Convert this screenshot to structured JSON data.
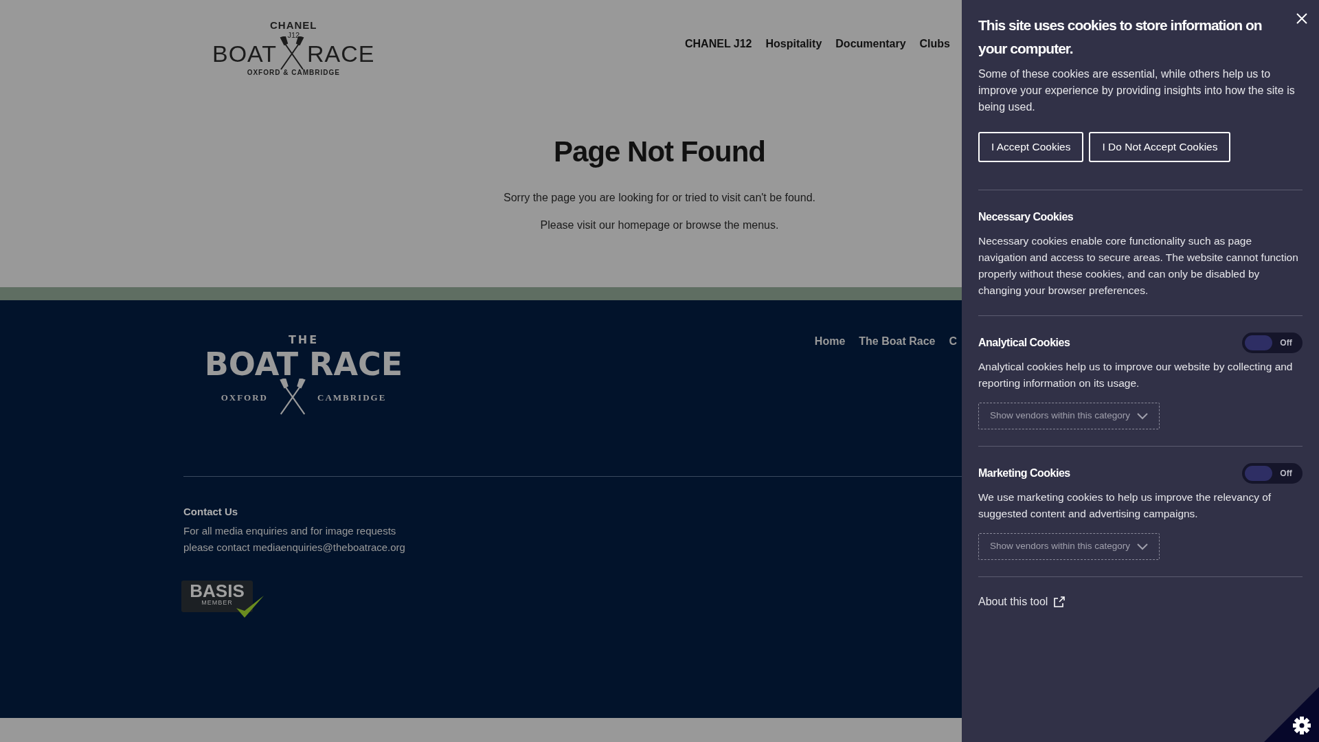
{
  "header": {
    "logo": {
      "top": "CHANEL",
      "model": "J12",
      "left": "BOAT",
      "right": "RACE",
      "bottom": "OXFORD & CAMBRIDGE"
    },
    "nav": [
      "CHANEL J12",
      "Hospitality",
      "Documentary",
      "Clubs"
    ]
  },
  "main": {
    "title": "Page Not Found",
    "lines": [
      "Sorry the page you are looking for or tried to visit can't be found.",
      "Please visit our homepage or browse the menus."
    ]
  },
  "footer": {
    "logo": {
      "top": "THE",
      "main": "BOAT RACE",
      "left": "OXFORD",
      "right": "CAMBRIDGE"
    },
    "nav": [
      "Home",
      "The Boat Race",
      "C"
    ],
    "contact": {
      "title": "Contact Us",
      "lines": [
        "For all media enquiries and for image requests",
        "please contact mediaenquiries@theboatrace.org"
      ]
    },
    "badge": {
      "name": "BASIS",
      "sub": "MEMBER"
    }
  },
  "cookie_panel": {
    "title": "This site uses cookies to store information on your computer.",
    "intro": "Some of these cookies are essential, while others help us to improve your experience by providing insights into how the site is being used.",
    "buttons": [
      "I Accept Cookies",
      "I Do Not Accept Cookies"
    ],
    "sections": [
      {
        "kind": "plain",
        "title": "Necessary Cookies",
        "text": "Necessary cookies enable core functionality such as page navigation and access to secure areas. The website cannot function properly without these cookies, and can only be disabled by changing your browser preferences."
      },
      {
        "kind": "toggle",
        "title": "Analytical Cookies",
        "on": false,
        "toggle_label": "Off",
        "text": "Analytical cookies help us to improve our website by collecting and reporting information on its usage.",
        "vendors": "Show vendors within this category"
      },
      {
        "kind": "toggle",
        "title": "Marketing Cookies",
        "on": false,
        "toggle_label": "Off",
        "text": "We use marketing cookies to help us improve the relevancy of suggested content and advertising campaigns.",
        "vendors": "Show vendors within this category"
      }
    ],
    "about": "About this tool"
  }
}
